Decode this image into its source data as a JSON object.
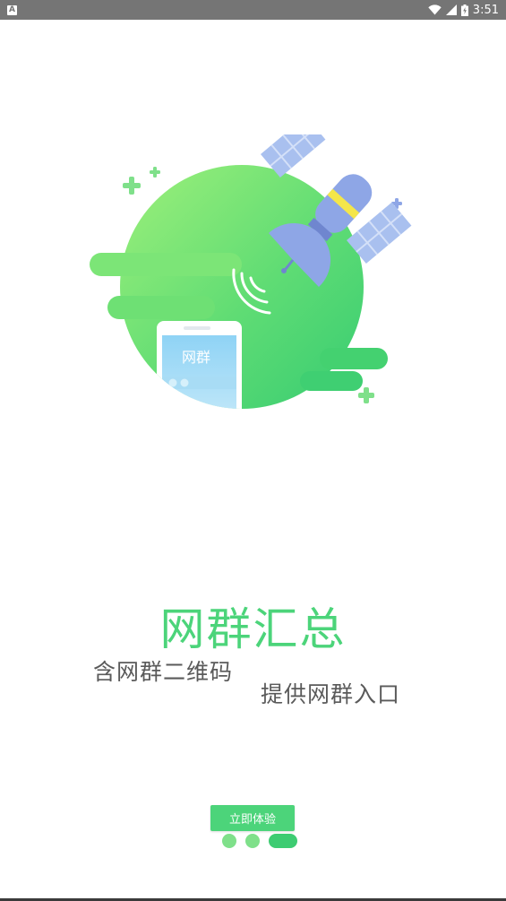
{
  "status_bar": {
    "notification_label": "A",
    "time": "3:51",
    "icons": [
      "wifi-icon",
      "signal-icon",
      "battery-charging-icon"
    ]
  },
  "onboarding": {
    "illustration_phone_label": "网群",
    "title": "网群汇总",
    "subtitle_1": "含网群二维码",
    "subtitle_2": "提供网群入口",
    "cta_label": "立即体验",
    "page_indicator": {
      "count": 3,
      "active_index": 2
    }
  },
  "colors": {
    "accent_green": "#4cd47a",
    "light_green": "#7fe08a",
    "status_bar_bg": "#757575",
    "satellite_blue": "#8ea6e6",
    "satellite_yellow": "#f4e64a"
  }
}
